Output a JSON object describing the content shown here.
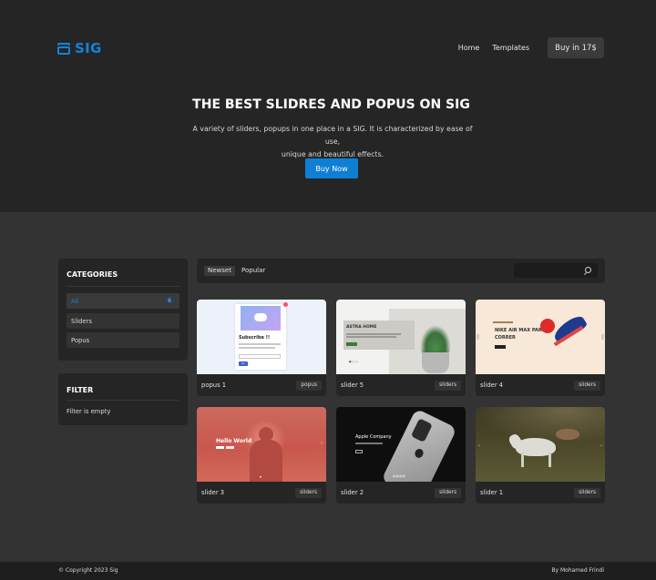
{
  "header": {
    "logo_text": "SIG",
    "nav": [
      {
        "label": "Home"
      },
      {
        "label": "Templates"
      }
    ],
    "buy_label": "Buy in 17$"
  },
  "hero": {
    "title": "THE BEST SLIDRES AND POPUS ON SIG",
    "description_line1": "A variety of sliders, popups in one place in a SIG. It is characterized by ease of use,",
    "description_line2": "unique and beautiful effects.",
    "cta_label": "Buy Now"
  },
  "categories": {
    "title": "CATEGORIES",
    "items": [
      {
        "label": "All",
        "count": "6"
      },
      {
        "label": "Sliders"
      },
      {
        "label": "Popus"
      }
    ]
  },
  "filter": {
    "title": "FILTER",
    "empty_text": "Filter is empty"
  },
  "toolbar": {
    "tabs": [
      {
        "label": "Newset"
      },
      {
        "label": "Popular"
      }
    ],
    "search_placeholder": ""
  },
  "cards": [
    {
      "title": "popus 1",
      "badge": "popus",
      "preview": {
        "heading": "Subscribe !!",
        "button": "Go"
      }
    },
    {
      "title": "slider 5",
      "badge": "sliders",
      "preview": {
        "heading": "ASTRA HOME"
      }
    },
    {
      "title": "slider 4",
      "badge": "sliders",
      "preview": {
        "heading_line1": "NIKE AIR MAX PARA",
        "heading_line2": "CORRER"
      }
    },
    {
      "title": "slider 3",
      "badge": "sliders",
      "preview": {
        "heading": "Hello World"
      }
    },
    {
      "title": "slider 2",
      "badge": "sliders",
      "preview": {
        "heading": "Apple Company"
      }
    },
    {
      "title": "slider 1",
      "badge": "sliders",
      "preview": {}
    }
  ],
  "footer": {
    "copyright": "© Copyright 2023 Sig",
    "author": "By Mohamed Frindi"
  },
  "colors": {
    "accent": "#0f7fd4",
    "hero_bg": "#252525",
    "page_bg": "#333333",
    "panel_bg": "#252525"
  }
}
